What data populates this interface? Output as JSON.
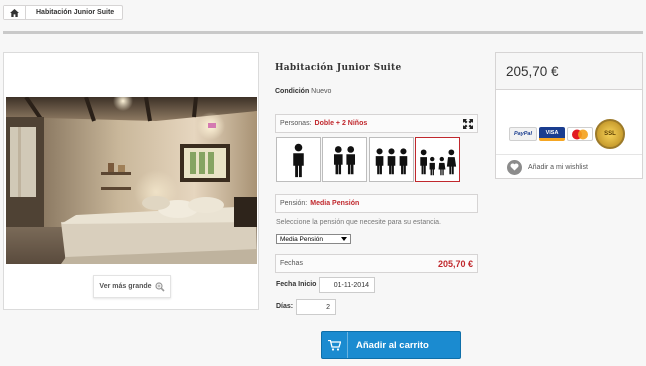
{
  "breadcrumb": {
    "home_icon": "home-icon",
    "current": "Habitación Junior Suite"
  },
  "product": {
    "title": "Habitación Junior Suite",
    "condition_label": "Condición",
    "condition_value": "Nuevo",
    "view_larger": "Ver más grande"
  },
  "persons": {
    "label": "Personas:",
    "value": "Doble + 2 Niños",
    "options": [
      {
        "name": "Individual",
        "icon": "single-person-icon"
      },
      {
        "name": "Doble",
        "icon": "two-persons-icon"
      },
      {
        "name": "Triple",
        "icon": "three-persons-icon"
      },
      {
        "name": "Doble + 2 Niños",
        "icon": "family-icon",
        "selected": true
      }
    ]
  },
  "pension": {
    "label": "Pensión:",
    "value": "Media Pensión",
    "help": "Seleccione la pensión que necesite para su estancia.",
    "selected_option": "Media Pensión"
  },
  "dates": {
    "label": "Fechas",
    "price": "205,70 €",
    "start_label": "Fecha Inicio",
    "start_value": "01-11-2014",
    "days_label": "Días:",
    "days_value": "2"
  },
  "cart": {
    "label": "Añadir al carrito"
  },
  "side": {
    "price": "205,70 €",
    "payments": [
      "PayPal",
      "VISA",
      "MasterCard",
      "SSL"
    ],
    "wishlist": "Añadir a mi wishlist"
  },
  "colors": {
    "accent_red": "#c0282d",
    "button_blue": "#1b8bd0"
  }
}
